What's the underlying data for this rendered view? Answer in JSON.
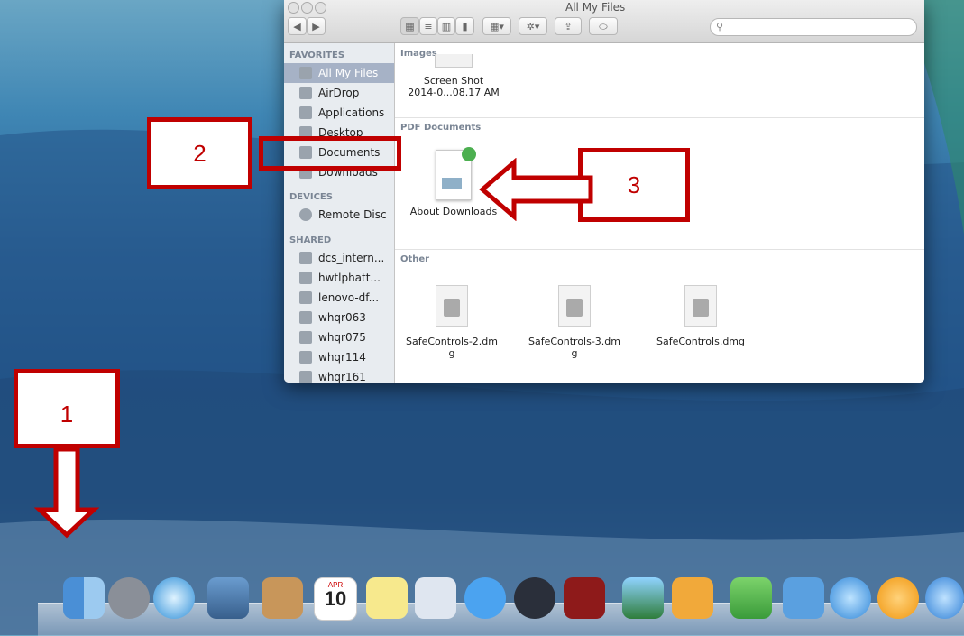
{
  "window": {
    "title": "All My Files",
    "toolbar": {
      "back_label": "◀",
      "forward_label": "▶",
      "search_placeholder": ""
    }
  },
  "sidebar": {
    "favorites_header": "FAVORITES",
    "favorites": [
      "All My Files",
      "AirDrop",
      "Applications",
      "Desktop",
      "Documents",
      "Downloads"
    ],
    "devices_header": "DEVICES",
    "devices": [
      "Remote Disc"
    ],
    "shared_header": "SHARED",
    "shared": [
      "dcs_intern...",
      "hwtlphatt...",
      "lenovo-df...",
      "whqr063",
      "whqr075",
      "whqr114",
      "whqr161"
    ]
  },
  "content": {
    "images_header": "Images",
    "image_file": {
      "line1": "Screen Shot",
      "line2": "2014-0...08.17 AM"
    },
    "pdf_header": "PDF Documents",
    "pdf_file": "About Downloads",
    "other_header": "Other",
    "other_files": [
      {
        "line1": "SafeControls-2.dm",
        "line2": "g"
      },
      {
        "line1": "SafeControls-3.dm",
        "line2": "g"
      },
      {
        "line1": "SafeControls.dmg",
        "line2": ""
      }
    ]
  },
  "annotations": {
    "box1": "1",
    "box2": "2",
    "box3": "3",
    "color": "#c00000"
  },
  "dock": {
    "calendar_month": "APR",
    "calendar_day": "10"
  }
}
